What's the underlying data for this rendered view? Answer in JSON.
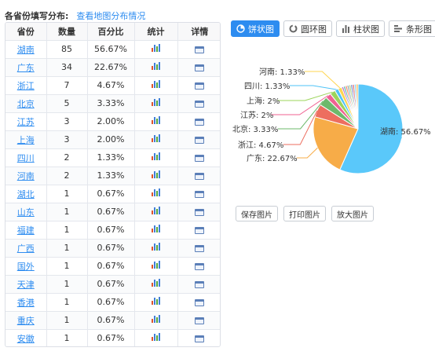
{
  "header": {
    "title": "各省份填写分布:",
    "map_link": "查看地图分布情况"
  },
  "table": {
    "columns": [
      "省份",
      "数量",
      "百分比",
      "统计",
      "详情"
    ],
    "rows": [
      {
        "province": "湖南",
        "count": "85",
        "percent": "56.67%"
      },
      {
        "province": "广东",
        "count": "34",
        "percent": "22.67%"
      },
      {
        "province": "浙江",
        "count": "7",
        "percent": "4.67%"
      },
      {
        "province": "北京",
        "count": "5",
        "percent": "3.33%"
      },
      {
        "province": "江苏",
        "count": "3",
        "percent": "2.00%"
      },
      {
        "province": "上海",
        "count": "3",
        "percent": "2.00%"
      },
      {
        "province": "四川",
        "count": "2",
        "percent": "1.33%"
      },
      {
        "province": "河南",
        "count": "2",
        "percent": "1.33%"
      },
      {
        "province": "湖北",
        "count": "1",
        "percent": "0.67%"
      },
      {
        "province": "山东",
        "count": "1",
        "percent": "0.67%"
      },
      {
        "province": "福建",
        "count": "1",
        "percent": "0.67%"
      },
      {
        "province": "广西",
        "count": "1",
        "percent": "0.67%"
      },
      {
        "province": "国外",
        "count": "1",
        "percent": "0.67%"
      },
      {
        "province": "天津",
        "count": "1",
        "percent": "0.67%"
      },
      {
        "province": "香港",
        "count": "1",
        "percent": "0.67%"
      },
      {
        "province": "重庆",
        "count": "1",
        "percent": "0.67%"
      },
      {
        "province": "安徽",
        "count": "1",
        "percent": "0.67%"
      }
    ]
  },
  "chart_tabs": [
    {
      "label": "饼状图",
      "icon": "pie-icon",
      "active": true
    },
    {
      "label": "圆环图",
      "icon": "ring-icon",
      "active": false
    },
    {
      "label": "柱状图",
      "icon": "bar-icon",
      "active": false
    },
    {
      "label": "条形图",
      "icon": "hbar-icon",
      "active": false
    }
  ],
  "actions": {
    "save": "保存图片",
    "print": "打印图片",
    "zoom": "放大图片"
  },
  "chart_data": {
    "type": "pie",
    "slices": [
      {
        "name": "湖南",
        "value": 85,
        "label": "湖南: 56.67%",
        "color": "#5ac8fa"
      },
      {
        "name": "广东",
        "value": 34,
        "label": "广东: 22.67%",
        "color": "#f7ac48"
      },
      {
        "name": "浙江",
        "value": 7,
        "label": "浙江: 4.67%",
        "color": "#ed6e5f"
      },
      {
        "name": "北京",
        "value": 5,
        "label": "北京: 3.33%",
        "color": "#6db96b"
      },
      {
        "name": "江苏",
        "value": 3,
        "label": "江苏: 2%",
        "color": "#f06292"
      },
      {
        "name": "上海",
        "value": 3,
        "label": "上海: 2%",
        "color": "#9cd45b"
      },
      {
        "name": "四川",
        "value": 2,
        "label": "四川: 1.33%",
        "color": "#4fc3f7"
      },
      {
        "name": "河南",
        "value": 2,
        "label": "河南: 1.33%",
        "color": "#ffd54f"
      },
      {
        "name": "湖北",
        "value": 1,
        "label": "",
        "color": "#ba68c8"
      },
      {
        "name": "山东",
        "value": 1,
        "label": "",
        "color": "#4db6ac"
      },
      {
        "name": "福建",
        "value": 1,
        "label": "",
        "color": "#ff8a65"
      },
      {
        "name": "广西",
        "value": 1,
        "label": "",
        "color": "#90a4ae"
      },
      {
        "name": "国外",
        "value": 1,
        "label": "",
        "color": "#aed581"
      },
      {
        "name": "天津",
        "value": 1,
        "label": "",
        "color": "#7986cb"
      },
      {
        "name": "香港",
        "value": 1,
        "label": "",
        "color": "#e57373"
      },
      {
        "name": "重庆",
        "value": 1,
        "label": "",
        "color": "#81d4fa"
      },
      {
        "name": "安徽",
        "value": 1,
        "label": "",
        "color": "#ffb74d"
      }
    ]
  }
}
